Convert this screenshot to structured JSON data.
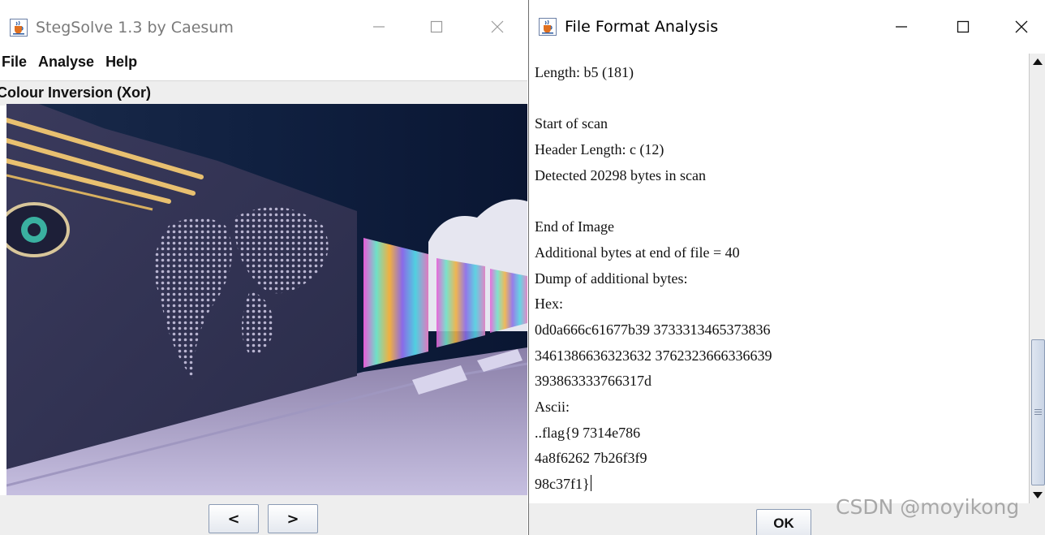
{
  "left_window": {
    "title": "StegSolve 1.3 by Caesum",
    "menu": [
      "File",
      "Analyse",
      "Help"
    ],
    "mode_label": "Colour Inversion (Xor)",
    "nav_prev": "<",
    "nav_next": ">"
  },
  "right_window": {
    "title": "File Format Analysis",
    "lines": [
      "Length: b5 (181)",
      "",
      "Start of scan",
      "Header Length: c (12)",
      "Detected 20298 bytes in scan",
      "",
      "End of Image",
      "Additional bytes at end of file = 40",
      "Dump of additional bytes:",
      "Hex:",
      "0d0a666c61677b39 3733313465373836",
      "3461386636323632 3762323666336639",
      "393863333766317d",
      "Ascii:",
      "..flag{9 7314e786",
      "4a8f6262 7b26f3f9",
      "98c37f1}"
    ],
    "ok_label": "OK"
  },
  "watermark": "CSDN @moyikong",
  "icons": {
    "app": "java-cup-icon",
    "minimize": "minimize-icon",
    "maximize": "maximize-icon",
    "close": "close-icon"
  },
  "colors": {
    "accent": "#8b9bb4",
    "window_bg": "#ffffff",
    "panel_bg": "#eeeeee"
  }
}
